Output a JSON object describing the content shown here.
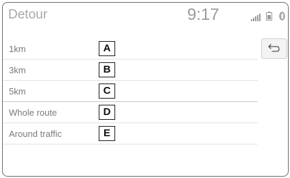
{
  "header": {
    "title": "Detour",
    "time": "9:17",
    "status_icons": [
      "signal-icon",
      "battery-icon",
      "bluetooth-icon"
    ]
  },
  "detour_options": [
    {
      "label": "1km",
      "marker": "A"
    },
    {
      "label": "3km",
      "marker": "B"
    },
    {
      "label": "5km",
      "marker": "C"
    },
    {
      "label": "Whole route",
      "marker": "D"
    },
    {
      "label": "Around traffic",
      "marker": "E"
    }
  ],
  "back_button": {
    "icon": "back-arrow-icon"
  },
  "colors": {
    "border": "#6a6a6a",
    "title_text": "#a8a8a8",
    "item_text": "#7a7a7a",
    "marker_border": "#1a1a1a"
  }
}
